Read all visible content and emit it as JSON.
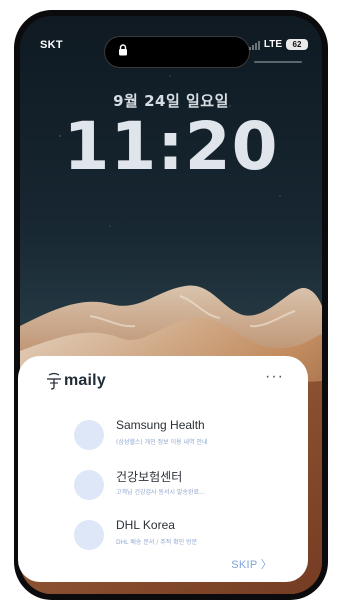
{
  "status_bar": {
    "carrier": "SKT",
    "network": "LTE",
    "battery": "62"
  },
  "lock_screen": {
    "date": "9월 24일 일요일",
    "time": "11:20"
  },
  "notification_card": {
    "brand": "maily",
    "more": "···",
    "messages": [
      {
        "sender": "Samsung Health",
        "preview": "(삼성헬스) 개인 정보 이용 내역 안내"
      },
      {
        "sender": "건강보험센터",
        "preview": "고객님 건강검사 동서시 발송완료..."
      },
      {
        "sender": "DHL Korea",
        "preview": "DHL 배송 문서 / 주적 확인 방문"
      }
    ],
    "skip_label": "SKIP 〉"
  }
}
